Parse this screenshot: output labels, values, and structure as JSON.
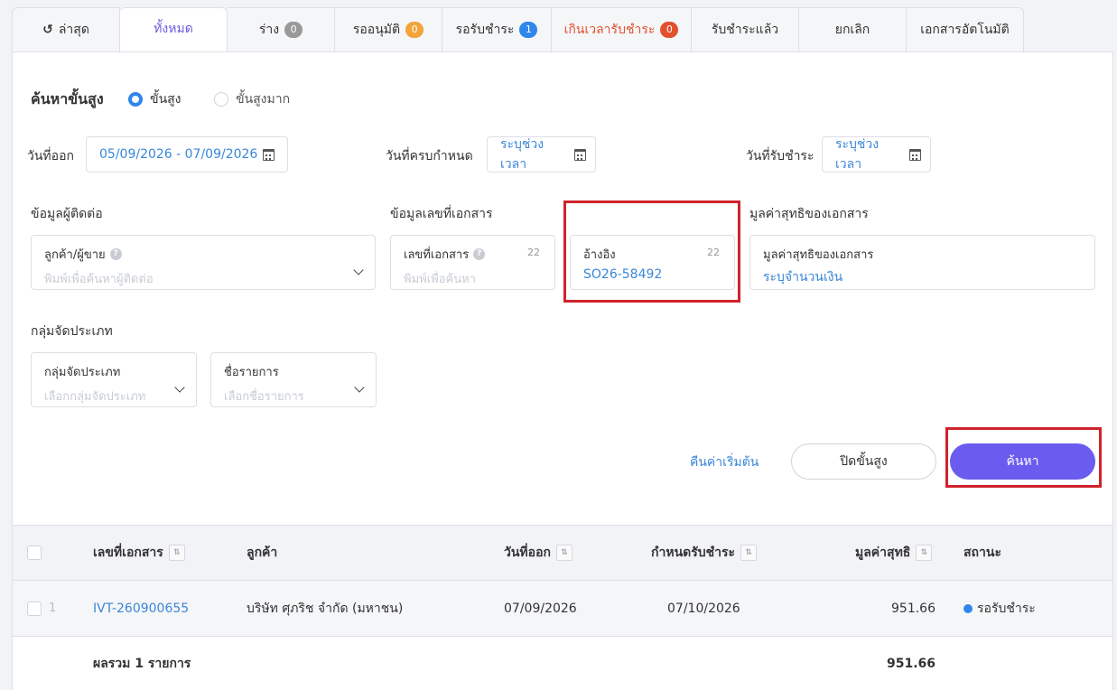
{
  "tabs": [
    {
      "label": "ล่าสุด",
      "icon": "history-icon"
    },
    {
      "label": "ทั้งหมด",
      "active": true
    },
    {
      "label": "ร่าง",
      "badge": "0",
      "badge_color": "#999999"
    },
    {
      "label": "รออนุมัติ",
      "badge": "0",
      "badge_color": "#f2a33a"
    },
    {
      "label": "รอรับชำระ",
      "badge": "1",
      "badge_color": "#2f86eb"
    },
    {
      "label": "เกินเวลารับชำระ",
      "badge": "0",
      "badge_color": "#e2502d"
    },
    {
      "label": "รับชำระแล้ว"
    },
    {
      "label": "ยกเลิก"
    },
    {
      "label": "เอกสารอัตโนมัติ"
    }
  ],
  "search": {
    "title": "ค้นหาขั้นสูง",
    "mode_advanced": "ขั้นสูง",
    "mode_very_advanced": "ขั้นสูงมาก",
    "issue_date_label": "วันที่ออก",
    "issue_date_value": "05/09/2026 - 07/09/2026",
    "due_date_label": "วันที่ครบกำหนด",
    "due_date_value": "ระบุช่วงเวลา",
    "paid_date_label": "วันที่รับชำระ",
    "paid_date_value": "ระบุช่วงเวลา",
    "contact_section": "ข้อมูลผู้ติดต่อ",
    "contact_field_label": "ลูกค้า/ผู้ขาย",
    "contact_field_placeholder": "พิมพ์เพื่อค้นหาผู้ติดต่อ",
    "doc_section": "ข้อมูลเลขที่เอกสาร",
    "doc_no_label": "เลขที่เอกสาร",
    "doc_no_placeholder": "พิมพ์เพื่อค้นหา",
    "doc_no_counter": "22",
    "ref_label": "อ้างอิง",
    "ref_value": "SO26-58492",
    "ref_counter": "22",
    "net_section": "มูลค่าสุทธิของเอกสาร",
    "net_field_label": "มูลค่าสุทธิของเอกสาร",
    "net_field_value": "ระบุจำนวนเงิน",
    "category_section": "กลุ่มจัดประเภท",
    "category_label": "กลุ่มจัดประเภท",
    "category_placeholder": "เลือกกลุ่มจัดประเภท",
    "item_label": "ชื่อรายการ",
    "item_placeholder": "เลือกชื่อรายการ",
    "reset_label": "คืนค่าเริ่มต้น",
    "close_label": "ปิดขั้นสูง",
    "search_label": "ค้นหา"
  },
  "table": {
    "headers": {
      "doc_no": "เลขที่เอกสาร",
      "customer": "ลูกค้า",
      "issue_date": "วันที่ออก",
      "due_date": "กำหนดรับชำระ",
      "net": "มูลค่าสุทธิ",
      "status": "สถานะ"
    },
    "rows": [
      {
        "index": "1",
        "doc_no": "IVT-260900655",
        "customer": "บริษัท ศุภริช จำกัด (มหาชน)",
        "issue_date": "07/09/2026",
        "due_date": "07/10/2026",
        "net": "951.66",
        "status": "รอรับชำระ"
      }
    ],
    "footer_label": "ผลรวม 1 รายการ",
    "footer_total": "951.66"
  }
}
